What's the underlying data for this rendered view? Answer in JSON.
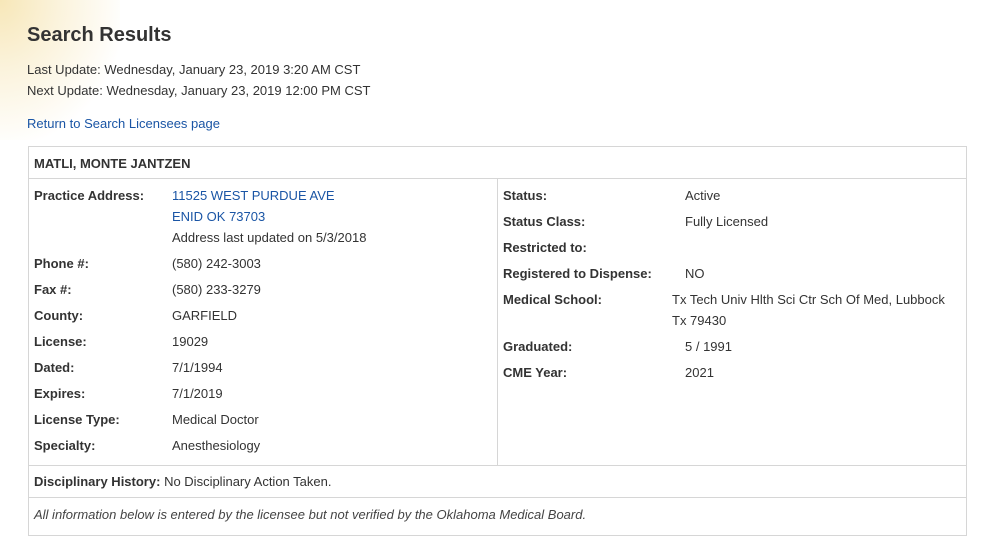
{
  "header": {
    "title": "Search Results",
    "last_update": "Last Update: Wednesday, January 23, 2019 3:20 AM CST",
    "next_update": "Next Update: Wednesday, January 23, 2019 12:00 PM CST",
    "return_link": "Return to Search Licensees page"
  },
  "licensee": {
    "name": "MATLI, MONTE JANTZEN",
    "left": {
      "practice_address_label": "Practice Address:",
      "address_line1": "11525 WEST PURDUE AVE",
      "address_line2": "ENID OK 73703",
      "address_updated": "Address last updated on 5/3/2018",
      "phone_label": "Phone #:",
      "phone": "(580) 242-3003",
      "fax_label": "Fax #:",
      "fax": "(580) 233-3279",
      "county_label": "County:",
      "county": "GARFIELD",
      "license_label": "License:",
      "license": "19029",
      "dated_label": "Dated:",
      "dated": "7/1/1994",
      "expires_label": "Expires:",
      "expires": "7/1/2019",
      "license_type_label": "License Type:",
      "license_type": "Medical Doctor",
      "specialty_label": "Specialty:",
      "specialty": "Anesthesiology"
    },
    "right": {
      "status_label": "Status:",
      "status": "Active",
      "status_class_label": "Status Class:",
      "status_class": "Fully Licensed",
      "restricted_label": "Restricted to:",
      "restricted": "",
      "dispense_label": "Registered to Dispense:",
      "dispense": "NO",
      "school_label": "Medical School:",
      "school_line1": "Tx Tech Univ Hlth Sci Ctr Sch Of Med, Lubbock",
      "school_line2": "Tx 79430",
      "graduated_label": "Graduated:",
      "graduated": "5 / 1991",
      "cme_label": "CME Year:",
      "cme": "2021"
    },
    "disciplinary_label": "Disciplinary History:",
    "disciplinary": "No Disciplinary Action Taken.",
    "note": "All information below is entered by the licensee but not verified by the Oklahoma Medical Board."
  }
}
